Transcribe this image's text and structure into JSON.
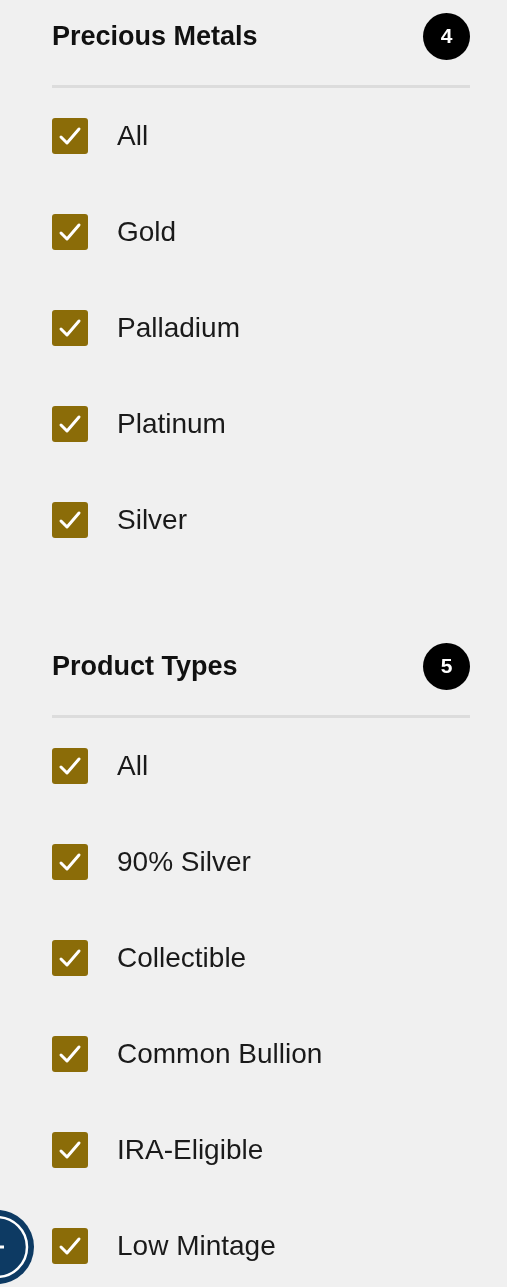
{
  "sections": [
    {
      "title": "Precious Metals",
      "count": "4",
      "options": [
        {
          "label": "All",
          "checked": true
        },
        {
          "label": "Gold",
          "checked": true
        },
        {
          "label": "Palladium",
          "checked": true
        },
        {
          "label": "Platinum",
          "checked": true
        },
        {
          "label": "Silver",
          "checked": true
        }
      ]
    },
    {
      "title": "Product Types",
      "count": "5",
      "options": [
        {
          "label": "All",
          "checked": true
        },
        {
          "label": "90% Silver",
          "checked": true
        },
        {
          "label": "Collectible",
          "checked": true
        },
        {
          "label": "Common Bullion",
          "checked": true
        },
        {
          "label": "IRA-Eligible",
          "checked": true
        },
        {
          "label": "Low Mintage",
          "checked": true
        }
      ]
    }
  ]
}
